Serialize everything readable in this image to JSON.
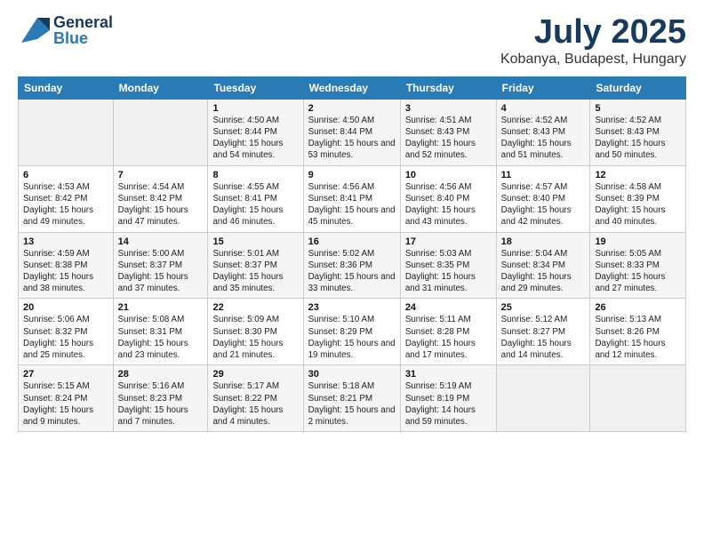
{
  "header": {
    "logo_general": "General",
    "logo_blue": "Blue",
    "month": "July 2025",
    "location": "Kobanya, Budapest, Hungary"
  },
  "weekdays": [
    "Sunday",
    "Monday",
    "Tuesday",
    "Wednesday",
    "Thursday",
    "Friday",
    "Saturday"
  ],
  "weeks": [
    [
      {
        "day": "",
        "info": ""
      },
      {
        "day": "",
        "info": ""
      },
      {
        "day": "1",
        "info": "Sunrise: 4:50 AM\nSunset: 8:44 PM\nDaylight: 15 hours\nand 54 minutes."
      },
      {
        "day": "2",
        "info": "Sunrise: 4:50 AM\nSunset: 8:44 PM\nDaylight: 15 hours\nand 53 minutes."
      },
      {
        "day": "3",
        "info": "Sunrise: 4:51 AM\nSunset: 8:43 PM\nDaylight: 15 hours\nand 52 minutes."
      },
      {
        "day": "4",
        "info": "Sunrise: 4:52 AM\nSunset: 8:43 PM\nDaylight: 15 hours\nand 51 minutes."
      },
      {
        "day": "5",
        "info": "Sunrise: 4:52 AM\nSunset: 8:43 PM\nDaylight: 15 hours\nand 50 minutes."
      }
    ],
    [
      {
        "day": "6",
        "info": "Sunrise: 4:53 AM\nSunset: 8:42 PM\nDaylight: 15 hours\nand 49 minutes."
      },
      {
        "day": "7",
        "info": "Sunrise: 4:54 AM\nSunset: 8:42 PM\nDaylight: 15 hours\nand 47 minutes."
      },
      {
        "day": "8",
        "info": "Sunrise: 4:55 AM\nSunset: 8:41 PM\nDaylight: 15 hours\nand 46 minutes."
      },
      {
        "day": "9",
        "info": "Sunrise: 4:56 AM\nSunset: 8:41 PM\nDaylight: 15 hours\nand 45 minutes."
      },
      {
        "day": "10",
        "info": "Sunrise: 4:56 AM\nSunset: 8:40 PM\nDaylight: 15 hours\nand 43 minutes."
      },
      {
        "day": "11",
        "info": "Sunrise: 4:57 AM\nSunset: 8:40 PM\nDaylight: 15 hours\nand 42 minutes."
      },
      {
        "day": "12",
        "info": "Sunrise: 4:58 AM\nSunset: 8:39 PM\nDaylight: 15 hours\nand 40 minutes."
      }
    ],
    [
      {
        "day": "13",
        "info": "Sunrise: 4:59 AM\nSunset: 8:38 PM\nDaylight: 15 hours\nand 38 minutes."
      },
      {
        "day": "14",
        "info": "Sunrise: 5:00 AM\nSunset: 8:37 PM\nDaylight: 15 hours\nand 37 minutes."
      },
      {
        "day": "15",
        "info": "Sunrise: 5:01 AM\nSunset: 8:37 PM\nDaylight: 15 hours\nand 35 minutes."
      },
      {
        "day": "16",
        "info": "Sunrise: 5:02 AM\nSunset: 8:36 PM\nDaylight: 15 hours\nand 33 minutes."
      },
      {
        "day": "17",
        "info": "Sunrise: 5:03 AM\nSunset: 8:35 PM\nDaylight: 15 hours\nand 31 minutes."
      },
      {
        "day": "18",
        "info": "Sunrise: 5:04 AM\nSunset: 8:34 PM\nDaylight: 15 hours\nand 29 minutes."
      },
      {
        "day": "19",
        "info": "Sunrise: 5:05 AM\nSunset: 8:33 PM\nDaylight: 15 hours\nand 27 minutes."
      }
    ],
    [
      {
        "day": "20",
        "info": "Sunrise: 5:06 AM\nSunset: 8:32 PM\nDaylight: 15 hours\nand 25 minutes."
      },
      {
        "day": "21",
        "info": "Sunrise: 5:08 AM\nSunset: 8:31 PM\nDaylight: 15 hours\nand 23 minutes."
      },
      {
        "day": "22",
        "info": "Sunrise: 5:09 AM\nSunset: 8:30 PM\nDaylight: 15 hours\nand 21 minutes."
      },
      {
        "day": "23",
        "info": "Sunrise: 5:10 AM\nSunset: 8:29 PM\nDaylight: 15 hours\nand 19 minutes."
      },
      {
        "day": "24",
        "info": "Sunrise: 5:11 AM\nSunset: 8:28 PM\nDaylight: 15 hours\nand 17 minutes."
      },
      {
        "day": "25",
        "info": "Sunrise: 5:12 AM\nSunset: 8:27 PM\nDaylight: 15 hours\nand 14 minutes."
      },
      {
        "day": "26",
        "info": "Sunrise: 5:13 AM\nSunset: 8:26 PM\nDaylight: 15 hours\nand 12 minutes."
      }
    ],
    [
      {
        "day": "27",
        "info": "Sunrise: 5:15 AM\nSunset: 8:24 PM\nDaylight: 15 hours\nand 9 minutes."
      },
      {
        "day": "28",
        "info": "Sunrise: 5:16 AM\nSunset: 8:23 PM\nDaylight: 15 hours\nand 7 minutes."
      },
      {
        "day": "29",
        "info": "Sunrise: 5:17 AM\nSunset: 8:22 PM\nDaylight: 15 hours\nand 4 minutes."
      },
      {
        "day": "30",
        "info": "Sunrise: 5:18 AM\nSunset: 8:21 PM\nDaylight: 15 hours\nand 2 minutes."
      },
      {
        "day": "31",
        "info": "Sunrise: 5:19 AM\nSunset: 8:19 PM\nDaylight: 14 hours\nand 59 minutes."
      },
      {
        "day": "",
        "info": ""
      },
      {
        "day": "",
        "info": ""
      }
    ]
  ]
}
